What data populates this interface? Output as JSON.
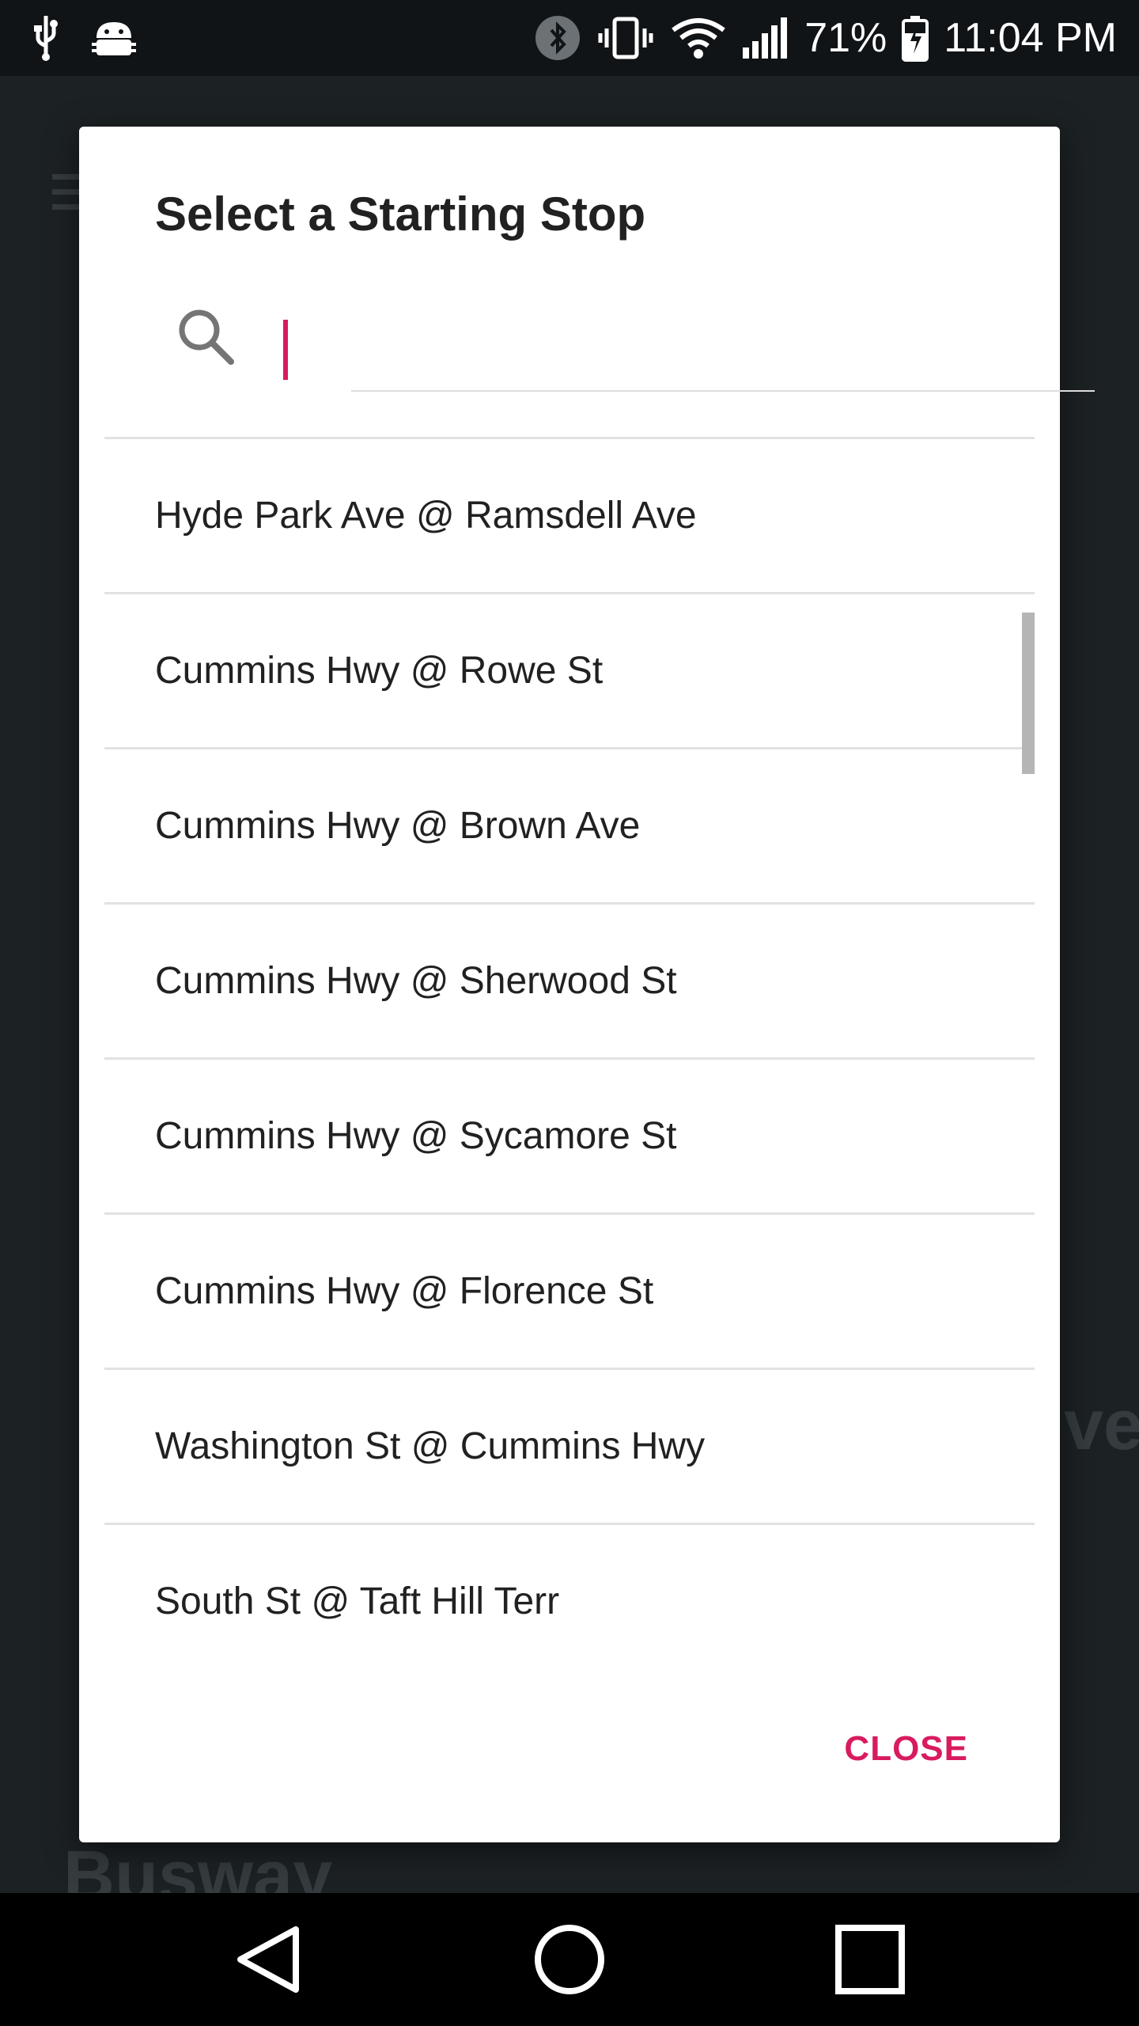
{
  "status_bar": {
    "battery_percent": "71%",
    "time": "11:04 PM",
    "icons": [
      "usb-icon",
      "android-debug-icon",
      "bluetooth-icon",
      "vibrate-icon",
      "wifi-icon",
      "signal-icon",
      "battery-charging-icon"
    ]
  },
  "dialog": {
    "title": "Select a Starting Stop",
    "search": {
      "value": "",
      "placeholder": ""
    },
    "stops": [
      "Hyde Park Ave @ Ramsdell Ave",
      "Cummins Hwy @ Rowe St",
      "Cummins Hwy @ Brown Ave",
      "Cummins Hwy @ Sherwood St",
      "Cummins Hwy @ Sycamore St",
      "Cummins Hwy @ Florence St",
      "Washington St @ Cummins Hwy",
      "South St @ Taft Hill Terr"
    ],
    "close_label": "CLOSE"
  },
  "background_app": {
    "partial_text_1": "Busway",
    "partial_text_2": "ve"
  },
  "colors": {
    "accent": "#d81b60",
    "dialog_bg": "#ffffff",
    "scrim": "#222a2e",
    "divider": "#e2e2e2"
  },
  "nav_bar": {
    "icons": [
      "back-icon",
      "home-icon",
      "recents-icon"
    ]
  }
}
